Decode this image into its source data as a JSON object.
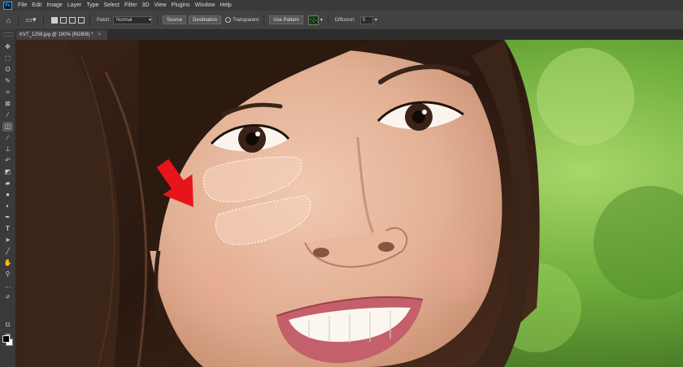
{
  "menu": {
    "logo": "Ps",
    "items": [
      "File",
      "Edit",
      "Image",
      "Layer",
      "Type",
      "Select",
      "Filter",
      "3D",
      "View",
      "Plugins",
      "Window",
      "Help"
    ]
  },
  "options": {
    "patch_label": "Patch:",
    "patch_value": "Normal",
    "source_label": "Source",
    "destination_label": "Destination",
    "transparent_label": "Transparent",
    "use_pattern_label": "Use Pattern",
    "diffusion_label": "Diffusion:",
    "diffusion_value": "5"
  },
  "document": {
    "tab_title": "KVT_1259.jpg @ 100% (RGB/8) *",
    "tab_close": "×"
  },
  "tools": [
    "move-icon",
    "marquee-icon",
    "lasso-icon",
    "quick-select-icon",
    "crop-icon",
    "frame-icon",
    "eyedropper-icon",
    "patch-icon",
    "brush-icon",
    "clone-stamp-icon",
    "history-brush-icon",
    "eraser-icon",
    "gradient-icon",
    "blur-icon",
    "dodge-icon",
    "pen-icon",
    "type-icon",
    "path-select-icon",
    "line-icon",
    "hand-icon",
    "zoom-icon",
    "more-icon"
  ],
  "colors": {
    "foreground": "#000000",
    "background": "#ffffff",
    "accent": "#31a8ff",
    "arrow": "#e8141b"
  }
}
